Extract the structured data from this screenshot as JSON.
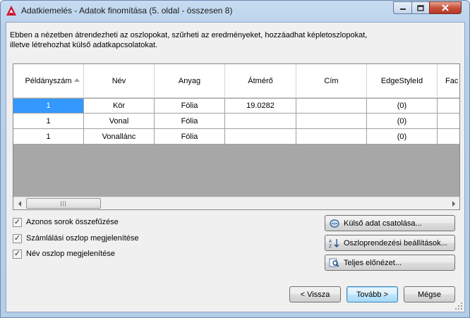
{
  "window": {
    "title": "Adatkiemelés - Adatok finomítása (5. oldal - összesen 8)"
  },
  "description": {
    "line1": "Ebben a nézetben átrendezheti az oszlopokat, szűrheti az eredményeket, hozzáadhat képletoszlopokat,",
    "line2": "illetve létrehozhat külső adatkapcsolatokat."
  },
  "grid": {
    "columns": [
      "Példányszám",
      "Név",
      "Anyag",
      "Átmérő",
      "Cím",
      "EdgeStyleId",
      "Fac"
    ],
    "sort_column": "Példányszám",
    "rows": [
      [
        "1",
        "Kör",
        "Fólia",
        "19.0282",
        "",
        "(0)",
        ""
      ],
      [
        "1",
        "Vonal",
        "Fólia",
        "",
        "",
        "(0)",
        ""
      ],
      [
        "1",
        "Vonallánc",
        "Fólia",
        "",
        "",
        "(0)",
        ""
      ]
    ],
    "selected_cell": "row 1, column Példányszám"
  },
  "options": {
    "combine_rows": {
      "label": "Azonos sorok összefűzése",
      "checked": true
    },
    "show_count": {
      "label": "Számlálási oszlop megjelenítése",
      "checked": true
    },
    "show_name": {
      "label": "Név oszlop megjelenítése",
      "checked": true
    }
  },
  "side_buttons": {
    "link_external": "Külső adat csatolása...",
    "sort_settings": "Oszloprendezési beállítások...",
    "full_preview": "Teljes előnézet..."
  },
  "nav_buttons": {
    "back": "< Vissza",
    "next": "Tovább >",
    "cancel": "Mégse"
  },
  "colors": {
    "selection": "#3399ff",
    "grid_empty": "#a7a7a7",
    "dialog_bg": "#f0f0f0"
  }
}
